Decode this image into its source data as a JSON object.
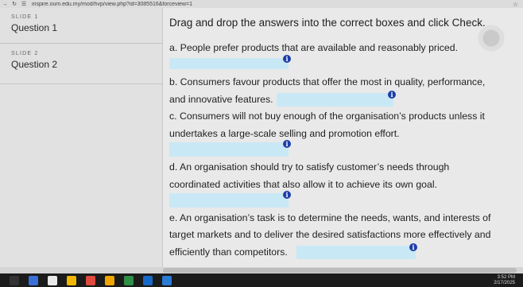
{
  "browser": {
    "back_icon": "back-arrow-icon",
    "forward_icon": "forward-arrow-icon",
    "reload_icon": "reload-icon",
    "url": "inspire.oum.edu.my/mod/hvp/view.php?id=3085516&forceview=1"
  },
  "sidebar": {
    "slides": [
      {
        "caption": "SLIDE 1",
        "label": "Question 1"
      },
      {
        "caption": "SLIDE 2",
        "label": "Question 2"
      }
    ]
  },
  "main": {
    "instruction": "Drag and drop the answers into the correct boxes and click Check.",
    "lines": {
      "a1": "a. People prefer products that are available and reasonably priced.",
      "b1": "b. Consumers favour products that offer the most in quality, performance,",
      "b2": "and innovative features.",
      "c1": "c. Consumers will not buy enough of the organisation’s products unless it",
      "c2": "undertakes a large-scale selling and promotion effort.",
      "d1": "d. An organisation should try to satisfy customer’s needs through",
      "d2": "coordinated activities that also allow it to achieve its own goal.",
      "e1": "e. An organisation’s task is to determine the needs, wants, and interests of",
      "e2": "target markets and to deliver the desired satisfactions more effectively and",
      "e3": "efficiently than competitors."
    },
    "info_glyph": "i"
  },
  "taskbar": {
    "time": "3:52 PM",
    "date": "2/17/2025",
    "colors": {
      "bar": "#1b1b1b",
      "drop_zone": "#c9e8f5",
      "info": "#1d3ea8"
    }
  }
}
